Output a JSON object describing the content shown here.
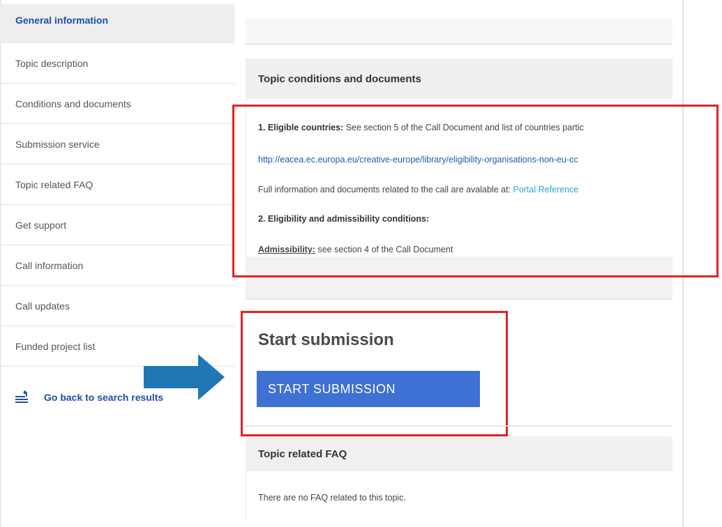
{
  "sidebar": {
    "items": [
      {
        "label": "General information",
        "active": true
      },
      {
        "label": "Topic description"
      },
      {
        "label": "Conditions and documents"
      },
      {
        "label": "Submission service"
      },
      {
        "label": "Topic related FAQ"
      },
      {
        "label": "Get support"
      },
      {
        "label": "Call information"
      },
      {
        "label": "Call updates"
      },
      {
        "label": "Funded project list"
      }
    ],
    "back_link": "Go back to search results"
  },
  "conditions": {
    "header": "Topic conditions and documents",
    "eligible_label": "1. Eligible countries:",
    "eligible_text": " See section 5 of the Call Document  and list of countries partic",
    "url": "http://eacea.ec.europa.eu/creative-europe/library/eligibility-organisations-non-eu-cc",
    "full_info_text": "Full information and documents related to the call are avalable at: ",
    "full_info_link": "Portal Reference",
    "eligibility_label": "2. Eligibility and admissibility conditions:",
    "admissibility_label": "Admissibility:",
    "admissibility_text": " see section 4 of the Call Document"
  },
  "submission": {
    "title": "Start submission",
    "button_label": "START SUBMISSION"
  },
  "faq": {
    "header": "Topic related FAQ",
    "empty_text": "There are no FAQ related to this topic."
  },
  "colors": {
    "highlight_box": "#e52025",
    "arrow": "#1f78b4",
    "button": "#3f70d4",
    "link": "#1f5bb0"
  }
}
